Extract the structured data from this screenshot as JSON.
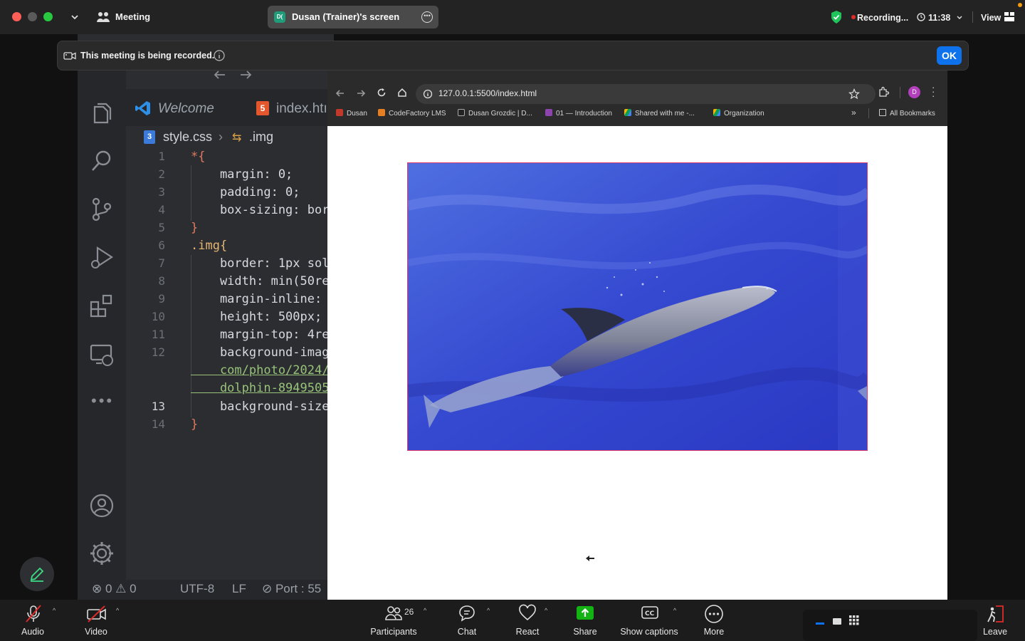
{
  "meeting": {
    "title": "Meeting",
    "screen_owner": "Dusan (Trainer)'s screen",
    "screen_badge": "D(",
    "recording": "Recording...",
    "time": "11:38",
    "view": "View"
  },
  "notice": {
    "message": "This meeting is being recorded.",
    "ok": "OK"
  },
  "vscode": {
    "tab_welcome": "Welcome",
    "tab_index": "index.htı",
    "breadcrumb_file": "style.css",
    "breadcrumb_symbol": ".img",
    "line_numbers": [
      "1",
      "2",
      "3",
      "4",
      "5",
      "6",
      "7",
      "8",
      "9",
      "10",
      "11",
      "12",
      "",
      "13",
      "14"
    ],
    "code": [
      "*{",
      "    margin: 0;",
      "    padding: 0;",
      "    box-sizing: bor",
      "}",
      ".img{",
      "    border: 1px sol",
      "    width: min(50re",
      "    margin-inline: ",
      "    height: 500px;",
      "    margin-top: 4re",
      "    background-imag",
      "    com/photo/2024/",
      "    dolphin-8949505",
      "    background-size",
      "}"
    ],
    "status_errors": "0",
    "status_warnings": "0",
    "status_encoding": "UTF-8",
    "status_eol": "LF",
    "status_port": "Port : 55"
  },
  "browser": {
    "url": "127.0.0.1:5500/index.html",
    "profile_initial": "D",
    "bookmarks": [
      "Dusan",
      "CodeFactory LMS",
      "Dusan Grozdic | D...",
      "01 — Introduction",
      "Shared with me -...",
      "Organization"
    ],
    "all_bookmarks": "All Bookmarks"
  },
  "toolbar": {
    "audio": "Audio",
    "video": "Video",
    "participants": "Participants",
    "participants_count": "26",
    "chat": "Chat",
    "react": "React",
    "share": "Share",
    "captions": "Show captions",
    "more": "More",
    "leave": "Leave"
  },
  "colors": {
    "zoom_blue": "#0e72ed",
    "share_green": "#14b314",
    "leave_red": "#e02b2b",
    "css_pink": "#e23b6e"
  }
}
